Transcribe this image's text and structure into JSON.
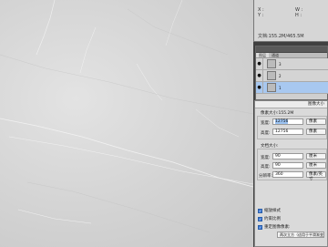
{
  "info_panel": {
    "x_label": "X :",
    "y_label": "Y :",
    "w_label": "W :",
    "h_label": "H :",
    "doc_text": "文档:155.2M/465.5M"
  },
  "layers_panel": {
    "tabs": [
      "图层",
      "通道"
    ],
    "layers": [
      {
        "name": "3"
      },
      {
        "name": "2"
      },
      {
        "name": "1"
      }
    ]
  },
  "image_size_dialog": {
    "title": "图像大小",
    "pixel_dimensions": "像素大小:155.2M",
    "width_label": "宽度:",
    "width_value": "12756",
    "width_unit": "像素",
    "height_label": "高度:",
    "height_value": "12756",
    "height_unit": "像素",
    "document_size": "文档大小:",
    "doc_width_label": "宽度:",
    "doc_width_value": "90",
    "doc_width_unit": "厘米",
    "doc_height_label": "高度:",
    "doc_height_value": "90",
    "doc_height_unit": "厘米",
    "resolution_label": "分辨率:",
    "resolution_value": "360",
    "resolution_unit": "像素/英寸",
    "scale_styles": "缩放样式",
    "constrain_proportions": "约束比例",
    "resample": "重定图像像素:",
    "resample_method": "两次立方（适用于平滑渐变）"
  }
}
